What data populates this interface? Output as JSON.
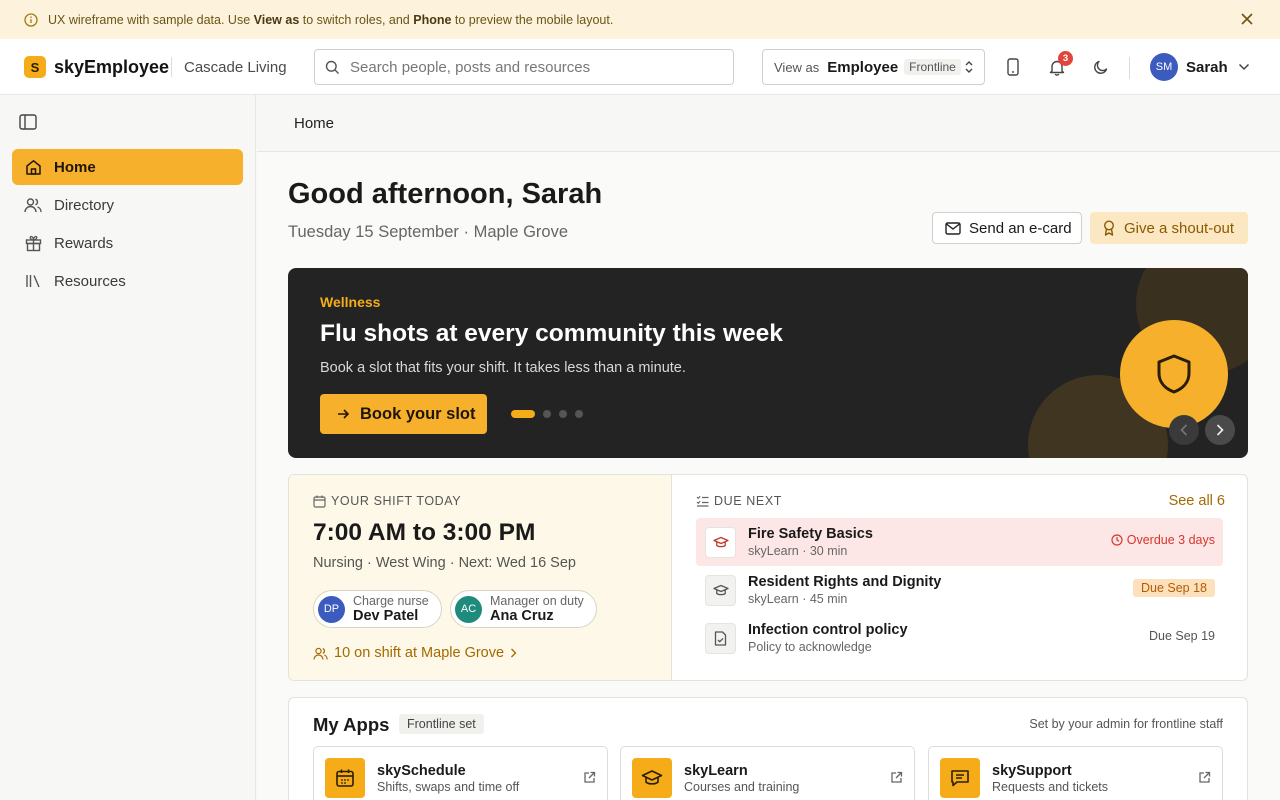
{
  "banner": {
    "text_1": "UX wireframe with sample data. Use ",
    "bold_1": "View as",
    "text_2": " to switch roles, and ",
    "bold_2": "Phone",
    "text_3": " to preview the mobile layout."
  },
  "header": {
    "logo_letter": "S",
    "app_name": "skyEmployee",
    "org_name": "Cascade Living",
    "search_placeholder": "Search people, posts and resources",
    "view_as_label": "View as",
    "view_as_role": "Employee",
    "view_as_sub": "Frontline",
    "notification_count": "3",
    "user_initials": "SM",
    "user_name": "Sarah"
  },
  "sidebar": {
    "items": [
      {
        "label": "Home",
        "icon": "home-icon",
        "active": true
      },
      {
        "label": "Directory",
        "icon": "people-icon",
        "active": false
      },
      {
        "label": "Rewards",
        "icon": "gift-icon",
        "active": false
      },
      {
        "label": "Resources",
        "icon": "library-icon",
        "active": false
      }
    ]
  },
  "breadcrumb": "Home",
  "greeting": {
    "title": "Good afternoon, Sarah",
    "subtitle": "Tuesday 15 September · Maple Grove",
    "ecard_label": "Send an e-card",
    "shoutout_label": "Give a shout-out"
  },
  "hero": {
    "kicker": "Wellness",
    "title": "Flu shots at every community this week",
    "subtitle": "Book a slot that fits your shift. It takes less than a minute.",
    "cta": "Book your slot",
    "slide_index": 1,
    "slide_count": 4
  },
  "shift": {
    "label": "YOUR SHIFT TODAY",
    "time": "7:00 AM to 3:00 PM",
    "meta": "Nursing · West Wing · Next: Wed 16 Sep",
    "people": [
      {
        "initials": "DP",
        "role": "Charge nurse",
        "name": "Dev Patel",
        "color": "#3b5bbf"
      },
      {
        "initials": "AC",
        "role": "Manager on duty",
        "name": "Ana Cruz",
        "color": "#1e8b7c"
      }
    ],
    "on_shift": "10 on shift at Maple Grove"
  },
  "due_next": {
    "label": "DUE NEXT",
    "see_all": "See all 6",
    "items": [
      {
        "title": "Fire Safety Basics",
        "sub": "skyLearn · 30 min",
        "status": "Overdue 3 days",
        "kind": "overdue"
      },
      {
        "title": "Resident Rights and Dignity",
        "sub": "skyLearn · 45 min",
        "status": "Due Sep 18",
        "kind": "due"
      },
      {
        "title": "Infection control policy",
        "sub": "Policy to acknowledge",
        "status": "Due Sep 19",
        "kind": "plain"
      }
    ]
  },
  "apps": {
    "title": "My Apps",
    "tag": "Frontline set",
    "note": "Set by your admin for frontline staff",
    "items": [
      {
        "name": "skySchedule",
        "desc": "Shifts, swaps and time off",
        "icon": "calendar-icon"
      },
      {
        "name": "skyLearn",
        "desc": "Courses and training",
        "icon": "graduation-cap-icon"
      },
      {
        "name": "skySupport",
        "desc": "Requests and tickets",
        "icon": "chat-icon"
      }
    ]
  },
  "colors": {
    "accent": "#f7b02b",
    "banner_bg": "#fdf3dc",
    "hero_bg": "#232323",
    "overdue": "#d6362c"
  }
}
